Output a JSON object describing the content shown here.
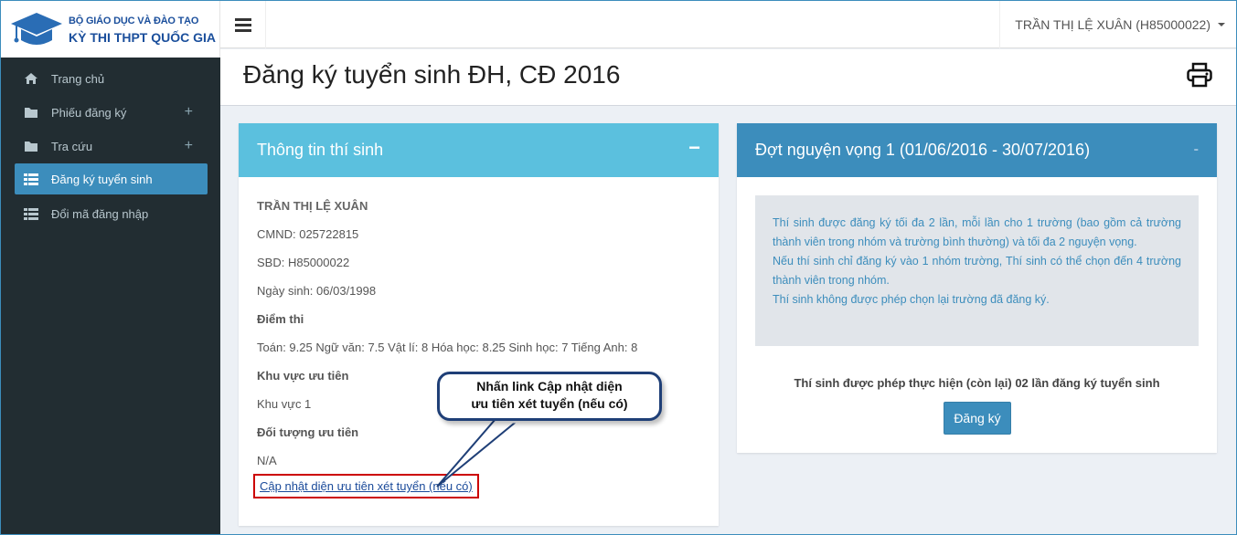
{
  "logo": {
    "line1": "BỘ GIÁO DỤC VÀ ĐÀO TẠO",
    "line2": "KỲ THI THPT QUỐC GIA"
  },
  "header": {
    "user_name": "TRẦN THỊ LỆ XUÂN (H85000022)"
  },
  "sidebar": {
    "items": [
      {
        "label": "Trang chủ",
        "icon": "home-icon"
      },
      {
        "label": "Phiếu đăng ký",
        "icon": "folder-icon",
        "plus": "+"
      },
      {
        "label": "Tra cứu",
        "icon": "folder-icon",
        "plus": "+"
      },
      {
        "label": "Đăng ký tuyển sinh",
        "icon": "list-icon"
      },
      {
        "label": "Đổi mã đăng nhập",
        "icon": "list-icon"
      }
    ]
  },
  "page": {
    "title": "Đăng ký tuyển sinh ĐH, CĐ 2016"
  },
  "left_box": {
    "title": "Thông tin thí sinh",
    "collapse": "−",
    "name": "TRẦN THỊ LỆ XUÂN",
    "cmnd": "CMND: 025722815",
    "sbd": "SBD: H85000022",
    "dob": "Ngày sinh: 06/03/1998",
    "scores_label": "Điểm thi",
    "scores": "Toán: 9.25 Ngữ văn: 7.5 Vật lí: 8 Hóa học: 8.25 Sinh học: 7 Tiếng Anh: 8",
    "area_label": "Khu vực ưu tiên",
    "area_value": "Khu vực 1",
    "target_label": "Đối tượng ưu tiên",
    "target_value": "N/A",
    "update_link": "Cập nhật diện ưu tiên xét tuyển (nếu có)"
  },
  "right_box": {
    "title": "Đợt nguyện vọng 1 (01/06/2016 - 30/07/2016)",
    "collapse": "-",
    "note_line1": "Thí sinh được đăng ký tối đa 2 lần, mỗi lần cho 1 trường (bao gồm cả trường thành viên trong nhóm và trường bình thường) và tối đa 2 nguyện vọng.",
    "note_line2": "Nếu thí sinh chỉ đăng ký vào 1 nhóm trường, Thí sinh có thể chọn đến 4 trường thành viên trong nhóm.",
    "note_line3": "Thí sinh không được phép chọn lại trường đã đăng ký.",
    "remaining": "Thí sinh được phép thực hiện (còn lại) 02 lần đăng ký tuyển sinh",
    "register_label": "Đăng ký"
  },
  "callout": {
    "line1": "Nhấn link Cập nhật diện",
    "line2": "ưu tiên xét tuyển (nếu có)"
  },
  "colors": {
    "brand": "#3c8dbc",
    "info": "#5bc0de",
    "sidebar": "#222d32",
    "highlight": "#cc0000"
  }
}
